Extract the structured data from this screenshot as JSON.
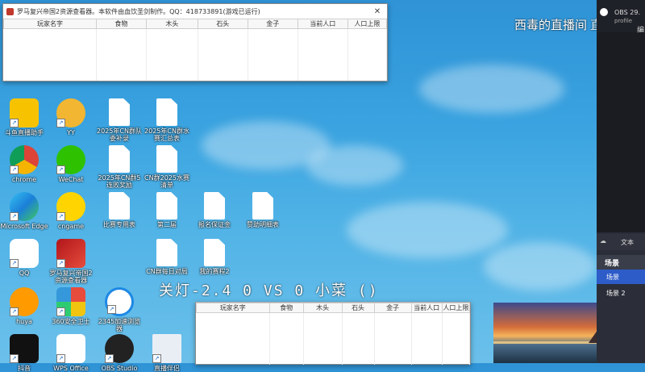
{
  "stream_title": "西毒的直播间",
  "stream_title_suffix": "直播",
  "top_window": {
    "title": "罗马复兴帝国2资源查看器。本软件由血饮圣剑制作。QQ：418733891(游戏已运行)",
    "columns": [
      "玩家名字",
      "食物",
      "木头",
      "石头",
      "金子",
      "当前人口",
      "人口上限"
    ]
  },
  "bottom_window": {
    "columns": [
      "玩家名字",
      "食物",
      "木头",
      "石头",
      "金子",
      "当前人口",
      "人口上限"
    ]
  },
  "match_overlay": "关灯-2.4 0  VS  0 小菜 ()",
  "desktop_icons": [
    {
      "label": "斗鱼直播助手",
      "icon": "camera-icon"
    },
    {
      "label": "YY",
      "icon": "yy-raccoon-icon"
    },
    {
      "label": "2025年CN群队委补录",
      "icon": "document-icon"
    },
    {
      "label": "2025年CN群水赛汇总表",
      "icon": "document-icon"
    },
    {
      "label": "chrome",
      "icon": "chrome-icon"
    },
    {
      "label": "WeChat",
      "icon": "wechat-icon"
    },
    {
      "label": "2025年CN群5连败奖励",
      "icon": "document-icon"
    },
    {
      "label": "CN群2025水赛清单",
      "icon": "document-icon"
    },
    {
      "label": "Microsoft Edge",
      "icon": "edge-icon"
    },
    {
      "label": "cngame",
      "icon": "cngame-icon"
    },
    {
      "label": "比赛专用表",
      "icon": "document-icon"
    },
    {
      "label": "第二届",
      "icon": "document-icon"
    },
    {
      "label": "报名保证金",
      "icon": "document-icon"
    },
    {
      "label": "赞助明细表",
      "icon": "document-icon"
    },
    {
      "label": "QQ",
      "icon": "qq-icon"
    },
    {
      "label": "罗马复兴帝国2资源查看器",
      "icon": "rome-game-icon"
    },
    {
      "label": "CN群每日对局",
      "icon": "document-icon"
    },
    {
      "label": "我的赛程2",
      "icon": "document-icon"
    },
    {
      "label": "huya",
      "icon": "huya-icon"
    },
    {
      "label": "360安全卫士",
      "icon": "360-icon"
    },
    {
      "label": "2345加速浏览器",
      "icon": "ie-icon"
    },
    {
      "label": "抖音",
      "icon": "tiktok-icon"
    },
    {
      "label": "WPS Office",
      "icon": "wps-icon"
    },
    {
      "label": "OBS Studio",
      "icon": "obs-icon"
    },
    {
      "label": "直播伴侣",
      "icon": "window-icon"
    }
  ],
  "obs": {
    "header": "OBS 29.",
    "sub": "profile",
    "side_char": "编",
    "text_source": "文本",
    "scenes_label": "场景",
    "scenes": [
      "场景",
      "场景 2"
    ],
    "active_scene": 0
  },
  "colors": {
    "accent": "#2d5cc8",
    "obs_bg": "#2b2e38"
  }
}
